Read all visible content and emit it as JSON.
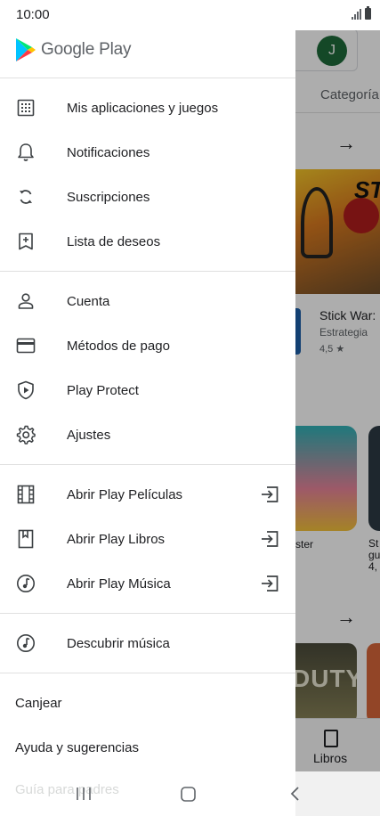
{
  "status_bar": {
    "time": "10:00",
    "icons": [
      "signal-icon",
      "battery-icon"
    ]
  },
  "background_app": {
    "avatar_letter": "J",
    "tab_label": "Categoría",
    "banner_text": "ST",
    "game_title": "Stick War:",
    "game_category": "Estrategia",
    "game_rating": "4,5 ★",
    "card1_label": "ster",
    "card2_label": "St gu 4,",
    "card3_text": "DUTY",
    "bottom_nav_label": "Libros"
  },
  "drawer": {
    "brand": "Google Play",
    "section1": [
      {
        "label": "Mis aplicaciones y juegos",
        "icon": "apps-grid-icon"
      },
      {
        "label": "Notificaciones",
        "icon": "bell-icon"
      },
      {
        "label": "Suscripciones",
        "icon": "refresh-icon"
      },
      {
        "label": "Lista de deseos",
        "icon": "bookmark-add-icon"
      }
    ],
    "section2": [
      {
        "label": "Cuenta",
        "icon": "person-icon"
      },
      {
        "label": "Métodos de pago",
        "icon": "credit-card-icon"
      },
      {
        "label": "Play Protect",
        "icon": "shield-play-icon"
      },
      {
        "label": "Ajustes",
        "icon": "gear-icon"
      }
    ],
    "section3": [
      {
        "label": "Abrir Play Películas",
        "icon": "film-icon"
      },
      {
        "label": "Abrir Play Libros",
        "icon": "book-icon"
      },
      {
        "label": "Abrir Play Música",
        "icon": "music-note-icon"
      }
    ],
    "section4": [
      {
        "label": "Descubrir música",
        "icon": "music-note-icon"
      }
    ],
    "section5": [
      {
        "label": "Canjear"
      },
      {
        "label": "Ayuda y sugerencias"
      },
      {
        "label": "Guía para padres"
      }
    ]
  },
  "colors": {
    "text": "#202124",
    "icon": "#3c4043",
    "divider": "#e0e0e0",
    "scrim": "rgba(0,0,0,0.32)"
  }
}
